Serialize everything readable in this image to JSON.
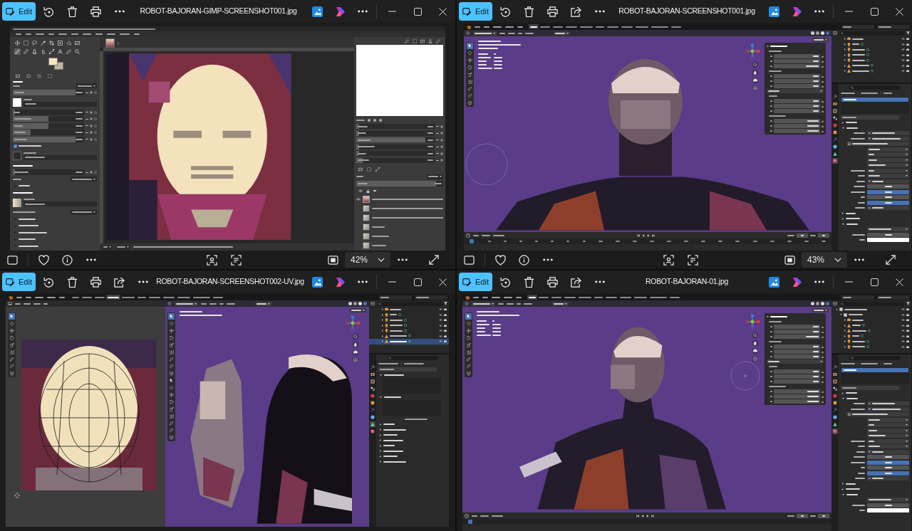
{
  "windows": [
    {
      "title": "ROBOT-BAJORAN-GIMP-SCREENSHOT001.jpg",
      "edit": "Edit",
      "share": false,
      "zoom": "42%",
      "image": {
        "kind": "paint"
      }
    },
    {
      "title": "ROBOT-BAJORAN-SCREENSHOT001.jpg",
      "edit": "Edit",
      "share": true,
      "zoom": "43%",
      "image": {
        "kind": "front"
      }
    },
    {
      "title": "ROBOT-BAJORAN-SCREENSHOT002-UV.jpg",
      "edit": "Edit",
      "share": true,
      "image": {
        "kind": "uv"
      }
    },
    {
      "title": "ROBOT-BAJORAN-01.jpg",
      "edit": "Edit",
      "share": true,
      "image": {
        "kind": "side"
      }
    }
  ]
}
